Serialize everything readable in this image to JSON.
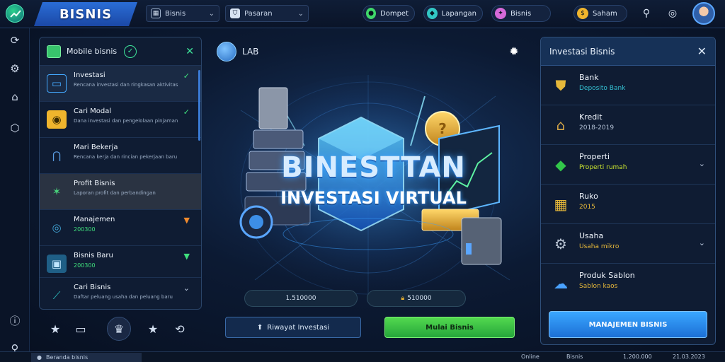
{
  "header": {
    "brand": "BISNIS",
    "selector1": "Bisnis",
    "selector2": "Pasaran",
    "pills": [
      {
        "label": "Dompet",
        "color": "#3fd86a"
      },
      {
        "label": "Lapangan",
        "color": "#32c7c5"
      },
      {
        "label": "Bisnis",
        "color": "#d66ad9"
      },
      {
        "label": "Saham",
        "color": "#f0b52d"
      }
    ]
  },
  "left_panel": {
    "title": "Mobile bisnis",
    "items": [
      {
        "title": "Investasi",
        "subtitle": "Rencana investasi dan ringkasan aktivitas",
        "color": "#44a9ff"
      },
      {
        "title": "Cari Modal",
        "subtitle": "Dana investasi dan pengelolaan pinjaman",
        "color": "#f0b52d"
      },
      {
        "title": "Mari Bekerja",
        "subtitle": "Rencana kerja dan rincian pekerjaan baru",
        "color": "#5b9fe6"
      },
      {
        "title": "Profit Bisnis",
        "subtitle": "Laporan profit dan perbandingan",
        "color": "#48d17a"
      },
      {
        "title": "Manajemen",
        "value": "200300",
        "color": "#42a5d6"
      },
      {
        "title": "Bisnis Baru",
        "value": "200300",
        "color": "#42a5d6"
      },
      {
        "title": "Cari Bisnis",
        "subtitle": "Daftar peluang usaha dan peluang baru",
        "color": "#2ec5c5"
      }
    ]
  },
  "center": {
    "label": "LAB",
    "hero_title": "BINESTTAN",
    "hero_subtitle": "INVESTASI VIRTUAL",
    "stat1": "1.510000",
    "stat2": "510000",
    "btn_history": "Riwayat Investasi",
    "btn_start": "Mulai Bisnis"
  },
  "right_panel": {
    "title": "Investasi Bisnis",
    "items": [
      {
        "title": "Bank",
        "subtitle": "Deposito Bank",
        "sub_color": "#35c4d6",
        "icon_color": "#e6b83a"
      },
      {
        "title": "Kredit",
        "subtitle": "2018-2019",
        "sub_color": "#b4c2d6",
        "icon_color": "#d4a547"
      },
      {
        "title": "Properti",
        "subtitle": "Properti rumah",
        "sub_color": "#c7e12f",
        "icon_color": "#32c74a"
      },
      {
        "title": "Ruko",
        "subtitle": "2015",
        "sub_color": "#e6b83a",
        "icon_color": "#e6b83a"
      },
      {
        "title": "Usaha",
        "subtitle": "Usaha mikro",
        "sub_color": "#e6b83a",
        "icon_color": "#b9c4d3"
      },
      {
        "title": "Produk Sablon",
        "subtitle": "Sablon kaos",
        "sub_color": "#e6b83a",
        "icon_color": "#4aa2ff"
      }
    ],
    "manage_button": "MANAJEMEN BISNIS"
  },
  "status": {
    "tab_label": "Beranda bisnis",
    "items": [
      "Online",
      "Bisnis",
      "1.200.000",
      "21.03.2023"
    ]
  }
}
